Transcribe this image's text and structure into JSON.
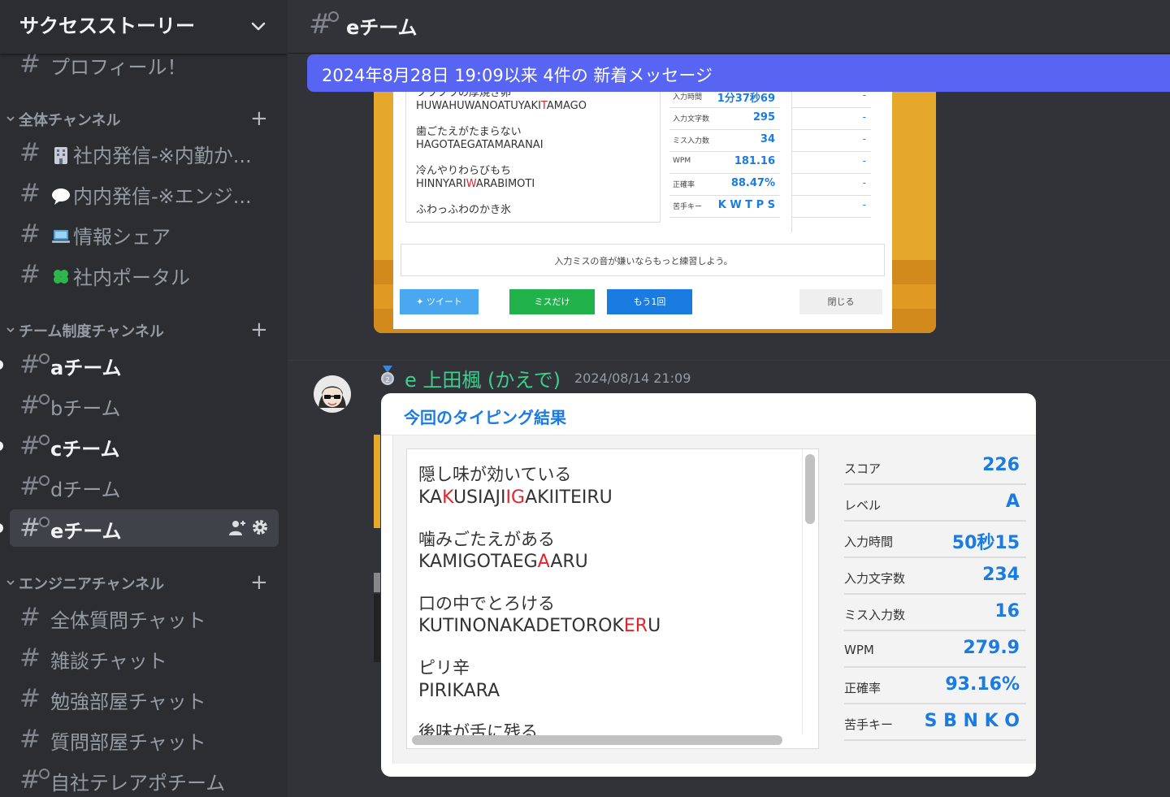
{
  "server": {
    "name": "サクセスストーリー"
  },
  "channels_top": [
    {
      "label": "プロフィール！"
    }
  ],
  "categories": [
    {
      "label": "全体チャンネル"
    },
    {
      "label": "チーム制度チャンネル"
    },
    {
      "label": "エンジニアチャンネル"
    }
  ],
  "general_channels": [
    {
      "label": "社内発信-※内勤か...",
      "emoji": "building-icon"
    },
    {
      "label": "内内発信-※エンジ...",
      "emoji": "speech-bubble-icon"
    },
    {
      "label": "情報シェア",
      "emoji": "laptop-icon"
    },
    {
      "label": "社内ポータル",
      "emoji": "four-leaf-clover-icon"
    }
  ],
  "team_channels": [
    {
      "label": "aチーム",
      "unread": true
    },
    {
      "label": "bチーム",
      "unread": false
    },
    {
      "label": "cチーム",
      "unread": true
    },
    {
      "label": "dチーム",
      "unread": false
    },
    {
      "label": "eチーム",
      "unread": true,
      "active": true
    }
  ],
  "engineer_channels": [
    {
      "label": "全体質問チャット"
    },
    {
      "label": "雑談チャット"
    },
    {
      "label": "勉強部屋チャット"
    },
    {
      "label": "質問部屋チャット"
    },
    {
      "label": "自社テレアポチーム"
    }
  ],
  "header": {
    "channel": "eチーム"
  },
  "new_messages_bar": {
    "text": "2024年8月28日 19:09以来 4件の 新着メッセージ"
  },
  "embed1": {
    "words": [
      {
        "jp": "フワフワの厚焼き卵",
        "roma_pre": "HUWAHUWANOATUYAKI",
        "roma_miss": "T",
        "roma_post": "AMAGO"
      },
      {
        "jp": "歯ごたえがたまらない",
        "roma_pre": "HAGOTAEGATAMARANAI",
        "roma_miss": "",
        "roma_post": ""
      },
      {
        "jp": "冷んやりわらびもち",
        "roma_pre": "HINNYARI",
        "roma_miss": "W",
        "roma_post": "ARABIMOTI"
      },
      {
        "jp": "ふわっふわのかき氷",
        "roma_pre": "",
        "roma_miss": "",
        "roma_post": ""
      }
    ],
    "stats": [
      {
        "label": "入力時間",
        "value": "1分37秒69",
        "prev": "-"
      },
      {
        "label": "入力文字数",
        "value": "295",
        "prev": "-"
      },
      {
        "label": "ミス入力数",
        "value": "34",
        "prev": "-"
      },
      {
        "label": "WPM",
        "value": "181.16",
        "prev": "-"
      },
      {
        "label": "正確率",
        "value": "88.47%",
        "prev": "-"
      },
      {
        "label": "苦手キー",
        "value": "K W T P S",
        "prev": "-"
      }
    ],
    "message": "入力ミスの音が嫌いならもっと練習しよう。",
    "buttons": {
      "tweet": "ツイート",
      "miss_only": "ミスだけ",
      "retry": "もう1回",
      "close": "閉じる"
    }
  },
  "message": {
    "author": "e 上田楓 (かえで)",
    "timestamp": "2024/08/14 21:09"
  },
  "embed2": {
    "title": "今回のタイピング結果",
    "words": [
      {
        "jp": "隠し味が効いている",
        "roma_pre": "KA",
        "roma_miss": "K",
        "roma_mid": "USIAJI",
        "roma_miss2": "IG",
        "roma_post": "AKIITEIRU"
      },
      {
        "jp": "噛みごたえがある",
        "roma_pre": "KAMIGOTAEG",
        "roma_miss": "A",
        "roma_mid": "ARU",
        "roma_miss2": "",
        "roma_post": ""
      },
      {
        "jp": "口の中でとろける",
        "roma_pre": "KUTINONAKADETOROK",
        "roma_miss": "ER",
        "roma_mid": "U",
        "roma_miss2": "",
        "roma_post": ""
      },
      {
        "jp": "ピリ辛",
        "roma_pre": "PIRIKARA",
        "roma_miss": "",
        "roma_mid": "",
        "roma_miss2": "",
        "roma_post": ""
      },
      {
        "jp": "後味が舌に残る",
        "roma_pre": "",
        "roma_miss": "",
        "roma_mid": "",
        "roma_miss2": "",
        "roma_post": ""
      }
    ],
    "stats": [
      {
        "label": "スコア",
        "value": "226"
      },
      {
        "label": "レベル",
        "value": "A"
      },
      {
        "label": "入力時間",
        "value": "50秒15"
      },
      {
        "label": "入力文字数",
        "value": "234"
      },
      {
        "label": "ミス入力数",
        "value": "16"
      },
      {
        "label": "WPM",
        "value": "279.9"
      },
      {
        "label": "正確率",
        "value": "93.16%"
      },
      {
        "label": "苦手キー",
        "value": "S B N K O"
      }
    ]
  },
  "colors": {
    "accent_blurple": "#5865f2",
    "author_green": "#3ecf8e",
    "result_blue": "#1a7be0",
    "miss_red": "#e0242c"
  }
}
